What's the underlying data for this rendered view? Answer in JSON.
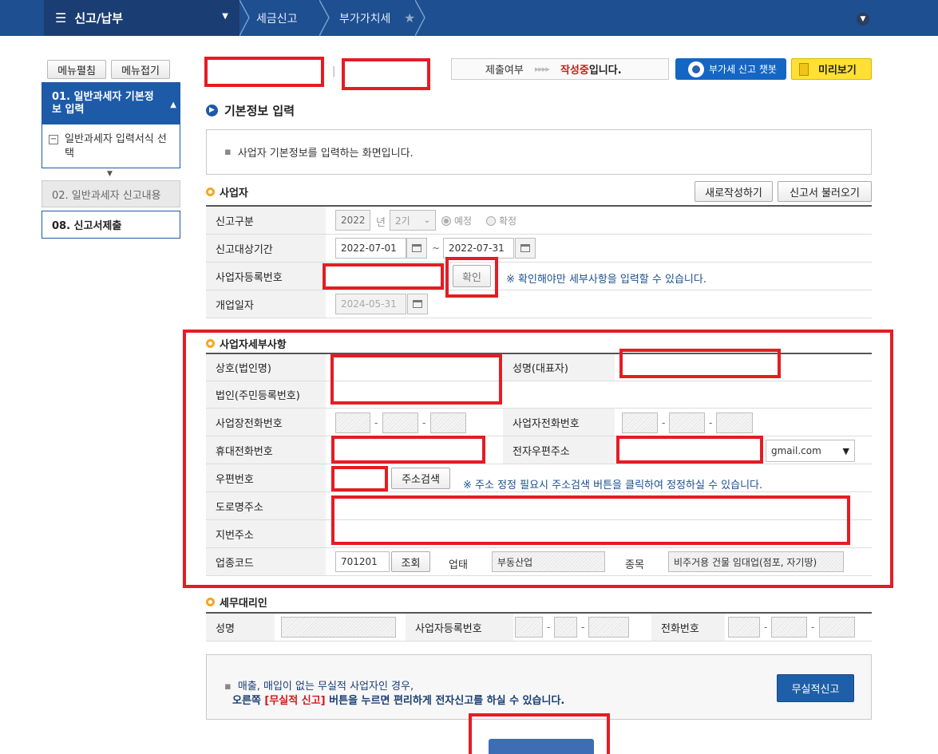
{
  "topbar": {
    "menu_title": "신고/납부",
    "crumbs": [
      "세금신고",
      "부가가치세"
    ]
  },
  "sidebar": {
    "expand_label": "메뉴펼침",
    "collapse_label": "메뉴접기",
    "step1_title": "01. 일반과세자 기본정보 입력",
    "step1_sub": "일반과세자 입력서식 선택",
    "step2_label": "02. 일반과세자 신고내용",
    "step8_label": "08. 신고서제출"
  },
  "status": {
    "label": "제출여부",
    "arrows": "▸▸▸▸",
    "value": "작성중",
    "suffix": "입니다."
  },
  "chatbot_label": "부가세 신고 챗봇",
  "preview_label": "미리보기",
  "section_title": "기본정보 입력",
  "info_text": "사업자 기본정보를 입력하는 화면입니다.",
  "business": {
    "title": "사업자",
    "new_btn": "새로작성하기",
    "load_btn": "신고서 불러오기",
    "report_type_label": "신고구분",
    "year": "2022",
    "year_unit": "년",
    "period": "2기",
    "radio_expected": "예정",
    "radio_final": "확정",
    "period_label": "신고대상기간",
    "date_from": "2022-07-01",
    "date_tilde": "~",
    "date_to": "2022-07-31",
    "reg_no_label": "사업자등록번호",
    "confirm_btn": "확인",
    "confirm_note": "※ 확인해야만 세부사항을 입력할 수 있습니다.",
    "open_date_label": "개업일자",
    "open_date": "2024-05-31"
  },
  "details": {
    "title": "사업자세부사항",
    "trade_name_label": "상호(법인명)",
    "rep_name_label": "성명(대표자)",
    "corp_label": "법인(주민등록번호)",
    "biz_phone_label": "사업장전화번호",
    "biz_tel_label": "사업자전화번호",
    "mobile_label": "휴대전화번호",
    "email_label": "전자우편주소",
    "email_domain": "gmail.com",
    "zip_label": "우편번호",
    "addr_search_btn": "주소검색",
    "addr_note": "※ 주소 정정 필요시 주소검색 버튼을 클릭하여 정정하실 수 있습니다.",
    "road_addr_label": "도로명주소",
    "lot_addr_label": "지번주소",
    "industry_label": "업종코드",
    "industry_code": "701201",
    "lookup_btn": "조회",
    "biz_type_label": "업태",
    "biz_type": "부동산업",
    "biz_item_label": "종목",
    "biz_item": "비주거용 건물 임대업(점포, 자기땅)"
  },
  "agent": {
    "title": "세무대리인",
    "name_label": "성명",
    "reg_no_label": "사업자등록번호",
    "phone_label": "전화번호"
  },
  "bottom": {
    "line1": "매출, 매입이 없는 무실적 사업자인 경우,",
    "line2_prefix": "오른쪽 ",
    "line2_highlight": "[무실적 신고]",
    "line2_suffix": " 버튼을 누르면 편리하게 전자신고를 하실 수 있습니다.",
    "no_sales_btn": "무실적신고"
  }
}
